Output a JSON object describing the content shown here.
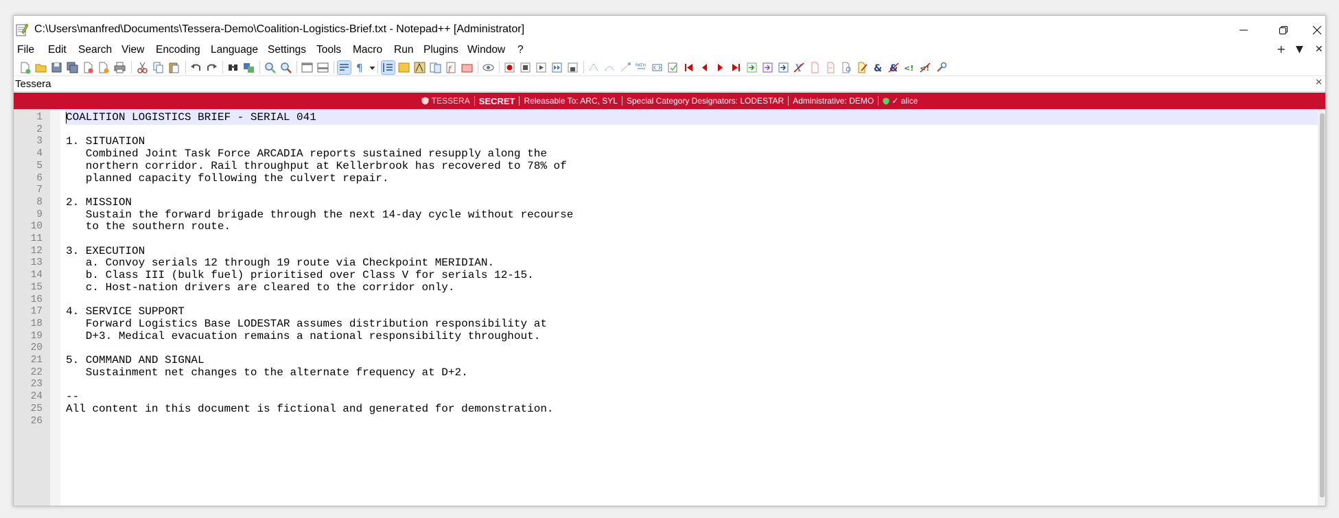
{
  "window": {
    "title": "C:\\Users\\manfred\\Documents\\Tessera-Demo\\Coalition-Logistics-Brief.txt - Notepad++ [Administrator]"
  },
  "menu": [
    "File",
    "Edit",
    "Search",
    "View",
    "Encoding",
    "Language",
    "Settings",
    "Tools",
    "Macro",
    "Run",
    "Plugins",
    "Window",
    "?"
  ],
  "menu_right": {
    "add": "+",
    "dropdown": "▼",
    "close": "✕"
  },
  "tab": {
    "label": "Tessera",
    "close": "✕"
  },
  "banner": {
    "brand": "TESSERA",
    "level": "SECRET",
    "releasable": "Releasable To: ARC, SYL",
    "special": "Special Category Designators: LODESTAR",
    "admin": "Administrative: DEMO",
    "user": "✓ alice",
    "background": "#c8102e"
  },
  "editor": {
    "lines": [
      {
        "n": "1",
        "text": "COALITION LOGISTICS BRIEF - SERIAL 041"
      },
      {
        "n": "2",
        "text": ""
      },
      {
        "n": "3",
        "text": "1. SITUATION"
      },
      {
        "n": "4",
        "text": "   Combined Joint Task Force ARCADIA reports sustained resupply along the"
      },
      {
        "n": "5",
        "text": "   northern corridor. Rail throughput at Kellerbrook has recovered to 78% of"
      },
      {
        "n": "6",
        "text": "   planned capacity following the culvert repair."
      },
      {
        "n": "7",
        "text": ""
      },
      {
        "n": "8",
        "text": "2. MISSION"
      },
      {
        "n": "9",
        "text": "   Sustain the forward brigade through the next 14-day cycle without recourse"
      },
      {
        "n": "10",
        "text": "   to the southern route."
      },
      {
        "n": "11",
        "text": ""
      },
      {
        "n": "12",
        "text": "3. EXECUTION"
      },
      {
        "n": "13",
        "text": "   a. Convoy serials 12 through 19 route via Checkpoint MERIDIAN."
      },
      {
        "n": "14",
        "text": "   b. Class III (bulk fuel) prioritised over Class V for serials 12-15."
      },
      {
        "n": "15",
        "text": "   c. Host-nation drivers are cleared to the corridor only."
      },
      {
        "n": "16",
        "text": ""
      },
      {
        "n": "17",
        "text": "4. SERVICE SUPPORT"
      },
      {
        "n": "18",
        "text": "   Forward Logistics Base LODESTAR assumes distribution responsibility at"
      },
      {
        "n": "19",
        "text": "   D+3. Medical evacuation remains a national responsibility throughout."
      },
      {
        "n": "20",
        "text": ""
      },
      {
        "n": "21",
        "text": "5. COMMAND AND SIGNAL"
      },
      {
        "n": "22",
        "text": "   Sustainment net changes to the alternate frequency at D+2."
      },
      {
        "n": "23",
        "text": ""
      },
      {
        "n": "24",
        "text": "--"
      },
      {
        "n": "25",
        "text": "All content in this document is fictional and generated for demonstration."
      },
      {
        "n": "26",
        "text": ""
      }
    ]
  }
}
